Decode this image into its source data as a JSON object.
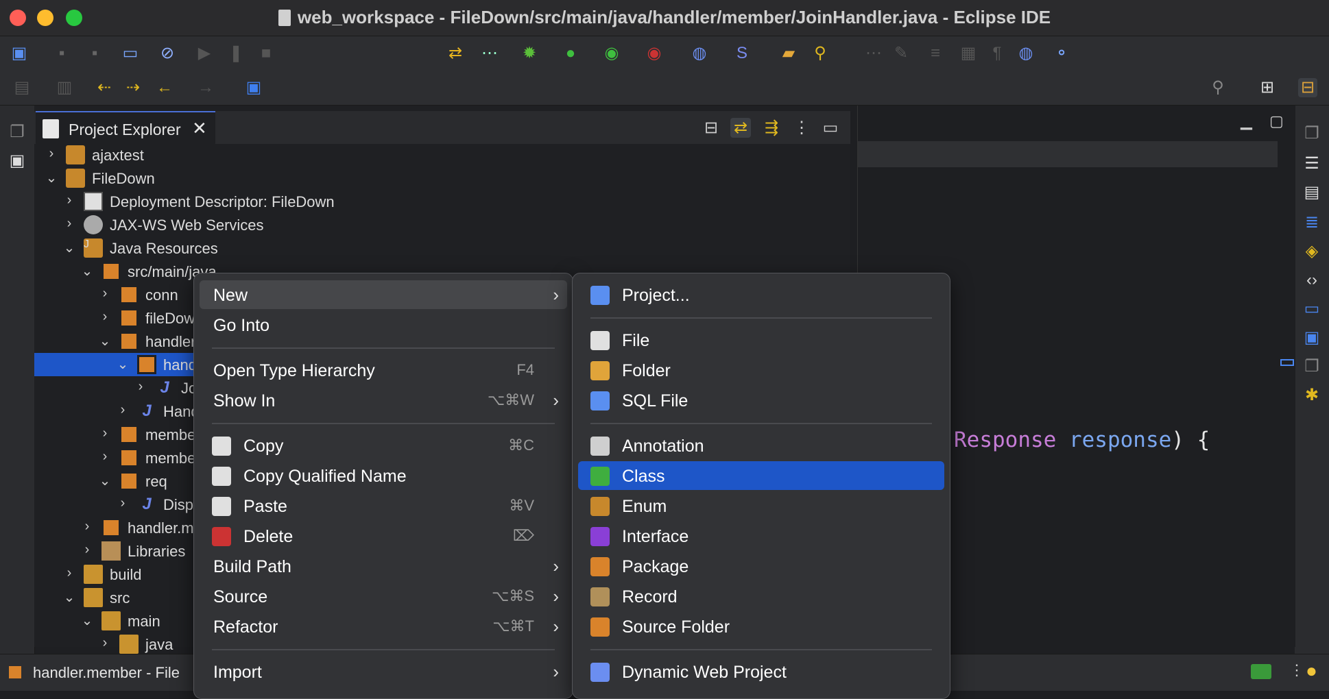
{
  "window": {
    "title": "web_workspace - FileDown/src/main/java/handler/member/JoinHandler.java - Eclipse IDE"
  },
  "project_explorer": {
    "tab_label": "Project Explorer",
    "tree": [
      {
        "label": "ajaxtest",
        "indent": 0,
        "expanded": false,
        "icon": "project-icon"
      },
      {
        "label": "FileDown",
        "indent": 0,
        "expanded": true,
        "icon": "project-icon"
      },
      {
        "label": "Deployment Descriptor: FileDown",
        "indent": 1,
        "expanded": false,
        "icon": "deployment-descriptor-icon"
      },
      {
        "label": "JAX-WS Web Services",
        "indent": 1,
        "expanded": false,
        "icon": "web-services-icon"
      },
      {
        "label": "Java Resources",
        "indent": 1,
        "expanded": true,
        "icon": "java-resources-icon"
      },
      {
        "label": "src/main/java",
        "indent": 2,
        "expanded": true,
        "icon": "source-folder-icon"
      },
      {
        "label": "conn",
        "indent": 3,
        "expanded": false,
        "icon": "package-icon"
      },
      {
        "label": "fileDow",
        "indent": 3,
        "expanded": false,
        "icon": "package-icon"
      },
      {
        "label": "handler",
        "indent": 3,
        "expanded": true,
        "icon": "package-icon"
      },
      {
        "label": "hand",
        "indent": 4,
        "expanded": true,
        "icon": "package-icon",
        "selected": true
      },
      {
        "label": "Jo",
        "indent": 5,
        "expanded": false,
        "icon": "java-file-icon"
      },
      {
        "label": "Hand",
        "indent": 4,
        "expanded": false,
        "icon": "java-interface-icon"
      },
      {
        "label": "membe",
        "indent": 3,
        "expanded": false,
        "icon": "package-warning-icon"
      },
      {
        "label": "membe",
        "indent": 3,
        "expanded": false,
        "icon": "package-warning-icon"
      },
      {
        "label": "req",
        "indent": 3,
        "expanded": true,
        "icon": "package-icon"
      },
      {
        "label": "Disp",
        "indent": 4,
        "expanded": false,
        "icon": "java-file-icon"
      },
      {
        "label": "handler.m",
        "indent": 2,
        "expanded": false,
        "icon": "package-icon"
      },
      {
        "label": "Libraries",
        "indent": 2,
        "expanded": false,
        "icon": "library-icon"
      },
      {
        "label": "build",
        "indent": 1,
        "expanded": false,
        "icon": "folder-icon"
      },
      {
        "label": "src",
        "indent": 1,
        "expanded": true,
        "icon": "folder-warning-icon"
      },
      {
        "label": "main",
        "indent": 2,
        "expanded": true,
        "icon": "folder-warning-icon"
      },
      {
        "label": "java",
        "indent": 3,
        "expanded": false,
        "icon": "folder-warning-icon"
      }
    ]
  },
  "editor": {
    "code_part1": "Response",
    "code_part2": "response",
    "code_part3": ") {"
  },
  "status": {
    "text": "handler.member - File"
  },
  "context_menu": {
    "items": [
      {
        "label": "New",
        "shortcut": "",
        "submenu": true,
        "icon": "",
        "state": "highlighted"
      },
      {
        "label": "Go Into",
        "shortcut": "",
        "submenu": false,
        "icon": ""
      },
      {
        "sep": true
      },
      {
        "label": "Open Type Hierarchy",
        "shortcut": "F4",
        "submenu": false,
        "icon": ""
      },
      {
        "label": "Show In",
        "shortcut": "⌥⌘W",
        "submenu": true,
        "icon": ""
      },
      {
        "sep": true
      },
      {
        "label": "Copy",
        "shortcut": "⌘C",
        "submenu": false,
        "icon": "copy-icon"
      },
      {
        "label": "Copy Qualified Name",
        "shortcut": "",
        "submenu": false,
        "icon": "copy-qualified-name-icon"
      },
      {
        "label": "Paste",
        "shortcut": "⌘V",
        "submenu": false,
        "icon": "paste-icon"
      },
      {
        "label": "Delete",
        "shortcut": "⌦",
        "submenu": false,
        "icon": "delete-icon"
      },
      {
        "label": "Build Path",
        "shortcut": "",
        "submenu": true,
        "icon": ""
      },
      {
        "label": "Source",
        "shortcut": "⌥⌘S",
        "submenu": true,
        "icon": ""
      },
      {
        "label": "Refactor",
        "shortcut": "⌥⌘T",
        "submenu": true,
        "icon": ""
      },
      {
        "sep": true
      },
      {
        "label": "Import",
        "shortcut": "",
        "submenu": true,
        "icon": ""
      }
    ]
  },
  "new_submenu": {
    "items": [
      {
        "label": "Project...",
        "icon": "new-project-icon"
      },
      {
        "sep": true
      },
      {
        "label": "File",
        "icon": "new-file-icon"
      },
      {
        "label": "Folder",
        "icon": "new-folder-icon"
      },
      {
        "label": "SQL File",
        "icon": "sql-file-icon"
      },
      {
        "sep": true
      },
      {
        "label": "Annotation",
        "icon": "annotation-icon"
      },
      {
        "label": "Class",
        "icon": "class-icon",
        "state": "selected"
      },
      {
        "label": "Enum",
        "icon": "enum-icon"
      },
      {
        "label": "Interface",
        "icon": "interface-icon"
      },
      {
        "label": "Package",
        "icon": "package-icon"
      },
      {
        "label": "Record",
        "icon": "record-icon"
      },
      {
        "label": "Source Folder",
        "icon": "source-folder-icon"
      },
      {
        "sep": true
      },
      {
        "label": "Dynamic Web Project",
        "icon": "dynamic-web-project-icon"
      }
    ]
  },
  "colors": {
    "accent": "#1e56c8",
    "keyword_pink": "#c77dd8",
    "identifier_blue": "#7ba7f0"
  }
}
